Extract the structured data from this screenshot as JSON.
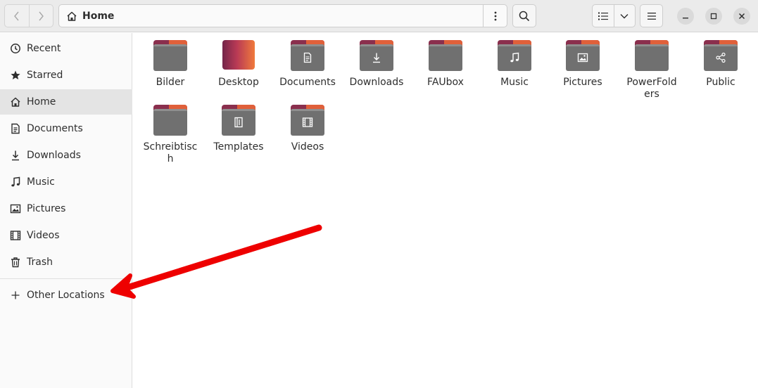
{
  "header": {
    "path_label": "Home"
  },
  "sidebar": {
    "items": [
      {
        "label": "Recent",
        "icon": "clock-icon"
      },
      {
        "label": "Starred",
        "icon": "star-icon"
      },
      {
        "label": "Home",
        "icon": "home-icon"
      },
      {
        "label": "Documents",
        "icon": "document-icon"
      },
      {
        "label": "Downloads",
        "icon": "download-icon"
      },
      {
        "label": "Music",
        "icon": "music-icon"
      },
      {
        "label": "Pictures",
        "icon": "picture-icon"
      },
      {
        "label": "Videos",
        "icon": "film-icon"
      },
      {
        "label": "Trash",
        "icon": "trash-icon"
      }
    ],
    "other_locations": "Other Locations"
  },
  "files": [
    {
      "name": "Bilder",
      "icon": "folder-icon"
    },
    {
      "name": "Desktop",
      "icon": "desktop-folder-icon"
    },
    {
      "name": "Documents",
      "icon": "documents-folder-icon"
    },
    {
      "name": "Downloads",
      "icon": "downloads-folder-icon"
    },
    {
      "name": "FAUbox",
      "icon": "folder-icon"
    },
    {
      "name": "Music",
      "icon": "music-folder-icon"
    },
    {
      "name": "Pictures",
      "icon": "pictures-folder-icon"
    },
    {
      "name": "PowerFolders",
      "icon": "folder-icon"
    },
    {
      "name": "Public",
      "icon": "public-folder-icon"
    },
    {
      "name": "Schreibtisch",
      "icon": "folder-icon"
    },
    {
      "name": "Templates",
      "icon": "templates-folder-icon"
    },
    {
      "name": "Videos",
      "icon": "videos-folder-icon"
    }
  ],
  "colors": {
    "accent_arrow": "#ee0000",
    "folder_body": "#707070",
    "folder_tab_dark": "#8a2f4d",
    "folder_tab_orange": "#e0603a",
    "sidebar_active": "#e4e4e4"
  }
}
